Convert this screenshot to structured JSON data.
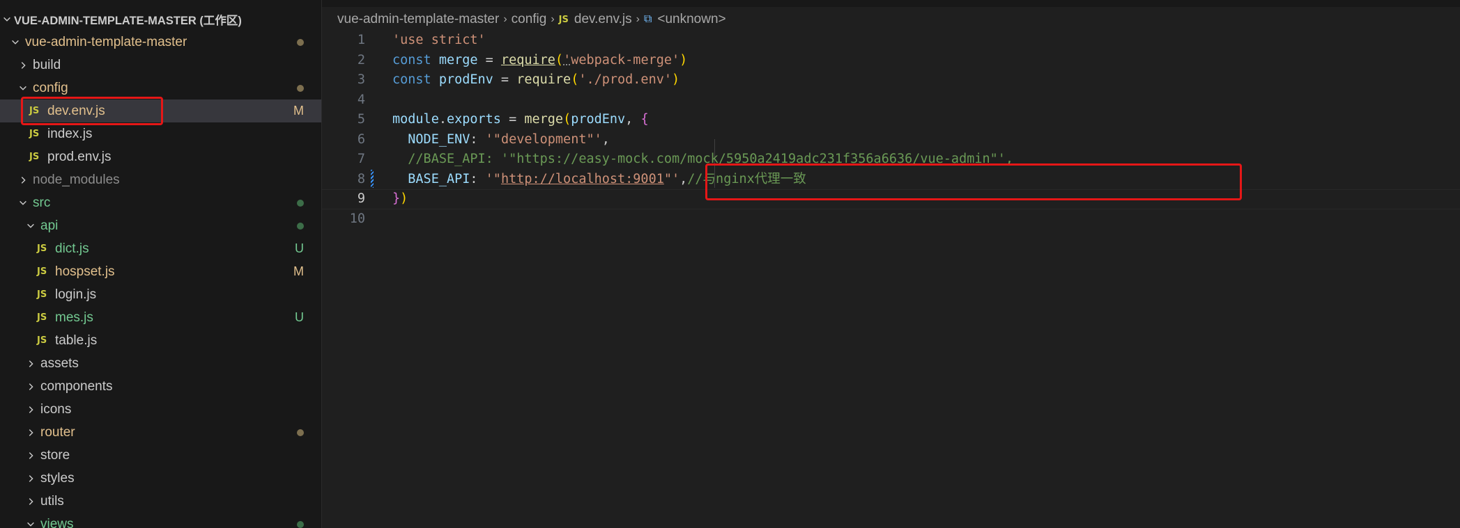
{
  "explorer": {
    "workspace_title": "VUE-ADMIN-TEMPLATE-MASTER (工作区)",
    "items": [
      {
        "label": "vue-admin-template-master",
        "kind": "folder",
        "open": true,
        "depth": 1,
        "color": "yellow",
        "status": "dot-yellow"
      },
      {
        "label": "build",
        "kind": "folder",
        "open": false,
        "depth": 2,
        "color": "white",
        "status": ""
      },
      {
        "label": "config",
        "kind": "folder",
        "open": true,
        "depth": 2,
        "color": "yellow",
        "status": "dot-yellow"
      },
      {
        "label": "dev.env.js",
        "kind": "js",
        "depth": 3,
        "color": "yellow",
        "status": "M",
        "selected": true
      },
      {
        "label": "index.js",
        "kind": "js",
        "depth": 3,
        "color": "white",
        "status": ""
      },
      {
        "label": "prod.env.js",
        "kind": "js",
        "depth": 3,
        "color": "white",
        "status": ""
      },
      {
        "label": "node_modules",
        "kind": "folder",
        "open": false,
        "depth": 2,
        "color": "grey",
        "status": ""
      },
      {
        "label": "src",
        "kind": "folder",
        "open": true,
        "depth": 2,
        "color": "green",
        "status": "dot-green"
      },
      {
        "label": "api",
        "kind": "folder",
        "open": true,
        "depth": 3,
        "color": "green",
        "status": "dot-green"
      },
      {
        "label": "dict.js",
        "kind": "js",
        "depth": 4,
        "color": "green",
        "status": "U"
      },
      {
        "label": "hospset.js",
        "kind": "js",
        "depth": 4,
        "color": "yellow",
        "status": "M"
      },
      {
        "label": "login.js",
        "kind": "js",
        "depth": 4,
        "color": "white",
        "status": ""
      },
      {
        "label": "mes.js",
        "kind": "js",
        "depth": 4,
        "color": "green",
        "status": "U"
      },
      {
        "label": "table.js",
        "kind": "js",
        "depth": 4,
        "color": "white",
        "status": ""
      },
      {
        "label": "assets",
        "kind": "folder",
        "open": false,
        "depth": 3,
        "color": "white",
        "status": ""
      },
      {
        "label": "components",
        "kind": "folder",
        "open": false,
        "depth": 3,
        "color": "white",
        "status": ""
      },
      {
        "label": "icons",
        "kind": "folder",
        "open": false,
        "depth": 3,
        "color": "white",
        "status": ""
      },
      {
        "label": "router",
        "kind": "folder",
        "open": false,
        "depth": 3,
        "color": "yellow",
        "status": "dot-yellow"
      },
      {
        "label": "store",
        "kind": "folder",
        "open": false,
        "depth": 3,
        "color": "white",
        "status": ""
      },
      {
        "label": "styles",
        "kind": "folder",
        "open": false,
        "depth": 3,
        "color": "white",
        "status": ""
      },
      {
        "label": "utils",
        "kind": "folder",
        "open": false,
        "depth": 3,
        "color": "white",
        "status": ""
      },
      {
        "label": "views",
        "kind": "folder",
        "open": true,
        "depth": 3,
        "color": "green",
        "status": "dot-green"
      }
    ],
    "js_icon_label": "JS"
  },
  "breadcrumb": {
    "parts": [
      "vue-admin-template-master",
      "config",
      "dev.env.js",
      "<unknown>"
    ],
    "file_icon": "JS",
    "symbol_icon": "symbol-variable-icon"
  },
  "editor": {
    "active_line": 9,
    "lines": [
      {
        "n": "1",
        "tokens": [
          [
            "t-str",
            "'use strict'"
          ]
        ]
      },
      {
        "n": "2",
        "tokens": [
          [
            "t-kw",
            "const "
          ],
          [
            "t-var",
            "merge"
          ],
          [
            "t-plain",
            " = "
          ],
          [
            "t-fn underline",
            "require"
          ],
          [
            "t-brk1",
            "("
          ],
          [
            "t-str underline-dotted",
            "'"
          ],
          [
            "t-str",
            "webpack-merge'"
          ],
          [
            "t-brk1",
            ")"
          ]
        ]
      },
      {
        "n": "3",
        "tokens": [
          [
            "t-kw",
            "const "
          ],
          [
            "t-var",
            "prodEnv"
          ],
          [
            "t-plain",
            " = "
          ],
          [
            "t-fn",
            "require"
          ],
          [
            "t-brk1",
            "("
          ],
          [
            "t-str",
            "'./prod.env'"
          ],
          [
            "t-brk1",
            ")"
          ]
        ]
      },
      {
        "n": "4",
        "tokens": []
      },
      {
        "n": "5",
        "tokens": [
          [
            "t-var",
            "module"
          ],
          [
            "t-plain",
            "."
          ],
          [
            "t-var",
            "exports"
          ],
          [
            "t-plain",
            " = "
          ],
          [
            "t-fn",
            "merge"
          ],
          [
            "t-brk1",
            "("
          ],
          [
            "t-var",
            "prodEnv"
          ],
          [
            "t-plain",
            ", "
          ],
          [
            "t-brk2",
            "{"
          ]
        ]
      },
      {
        "n": "6",
        "tokens": [
          [
            "t-plain",
            "  "
          ],
          [
            "t-var",
            "NODE_ENV"
          ],
          [
            "t-plain",
            ": "
          ],
          [
            "t-str",
            "'\"development\"'"
          ],
          [
            "t-plain",
            ","
          ]
        ]
      },
      {
        "n": "7",
        "tokens": [
          [
            "t-plain",
            "  "
          ],
          [
            "t-cmt",
            "//BASE_API: '\"https://easy-mock.com/mock/5950a2419adc231f356a6636/vue-admin\"',"
          ]
        ]
      },
      {
        "n": "8",
        "tokens": [
          [
            "t-plain",
            "  "
          ],
          [
            "t-var",
            "BASE_API"
          ],
          [
            "t-plain",
            ": "
          ],
          [
            "t-str",
            "'\""
          ],
          [
            "t-str underline",
            "http://localhost:9001"
          ],
          [
            "t-str",
            "\"'"
          ],
          [
            "t-plain",
            ","
          ],
          [
            "t-cmt",
            "//与nginx代理一致"
          ]
        ]
      },
      {
        "n": "9",
        "tokens": [
          [
            "t-brk2",
            "}"
          ],
          [
            "t-brk1",
            ")"
          ]
        ]
      },
      {
        "n": "10",
        "tokens": []
      }
    ]
  }
}
